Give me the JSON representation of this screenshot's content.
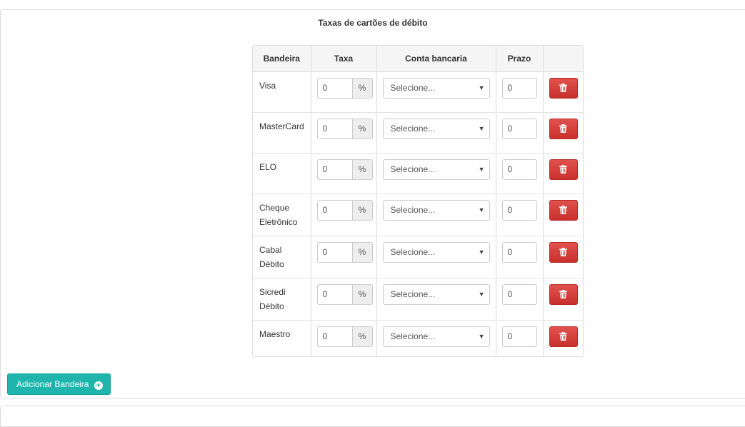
{
  "panel": {
    "title": "Taxas de cartões de débito"
  },
  "table": {
    "headers": {
      "bandeira": "Bandeira",
      "taxa": "Taxa",
      "conta": "Conta bancaria",
      "prazo": "Prazo"
    },
    "rows": [
      {
        "bandeira_line1": "Visa",
        "bandeira_line2": "",
        "taxa": "0",
        "unit": "%",
        "conta": "Selecione...",
        "prazo": "0"
      },
      {
        "bandeira_line1": "MasterCard",
        "bandeira_line2": "",
        "taxa": "0",
        "unit": "%",
        "conta": "Selecione...",
        "prazo": "0"
      },
      {
        "bandeira_line1": "ELO",
        "bandeira_line2": "",
        "taxa": "0",
        "unit": "%",
        "conta": "Selecione...",
        "prazo": "0"
      },
      {
        "bandeira_line1": "Cheque",
        "bandeira_line2": "Eletrônico",
        "taxa": "0",
        "unit": "%",
        "conta": "Selecione...",
        "prazo": "0"
      },
      {
        "bandeira_line1": "Cabal",
        "bandeira_line2": "Débito",
        "taxa": "0",
        "unit": "%",
        "conta": "Selecione...",
        "prazo": "0"
      },
      {
        "bandeira_line1": "Sicredi",
        "bandeira_line2": "Débito",
        "taxa": "0",
        "unit": "%",
        "conta": "Selecione...",
        "prazo": "0"
      },
      {
        "bandeira_line1": "Maestro",
        "bandeira_line2": "",
        "taxa": "0",
        "unit": "%",
        "conta": "Selecione...",
        "prazo": "0"
      }
    ]
  },
  "actions": {
    "add_label": "Adicionar Bandeira"
  },
  "icons": {
    "delete": "trash-icon",
    "add": "plus-circle-icon",
    "select": "caret-down-icon"
  },
  "colors": {
    "delete_button": "#d9534f",
    "add_button": "#1fb5ac",
    "header_bg": "#f5f5f5"
  }
}
